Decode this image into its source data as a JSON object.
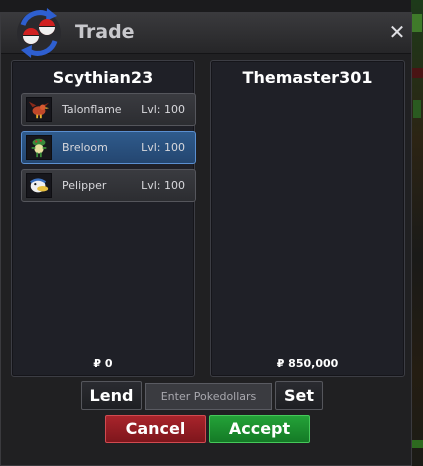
{
  "window": {
    "title": "Trade",
    "close_glyph": "✕"
  },
  "left_panel": {
    "player_name": "Scythian23",
    "money": "₽ 0",
    "pokemon": [
      {
        "name": "Talonflame",
        "level": "Lvl: 100",
        "sprite": "talonflame-icon",
        "selected": false
      },
      {
        "name": "Breloom",
        "level": "Lvl: 100",
        "sprite": "breloom-icon",
        "selected": true
      },
      {
        "name": "Pelipper",
        "level": "Lvl: 100",
        "sprite": "pelipper-icon",
        "selected": false
      }
    ]
  },
  "right_panel": {
    "player_name": "Themaster301",
    "money": "₽ 850,000"
  },
  "controls": {
    "lend_label": "Lend",
    "money_placeholder": "Enter Pokedollars",
    "set_label": "Set",
    "cancel_label": "Cancel",
    "accept_label": "Accept"
  },
  "colors": {
    "selected": "#2f5b8c",
    "cancel": "#a8242b",
    "accept": "#24a238"
  }
}
